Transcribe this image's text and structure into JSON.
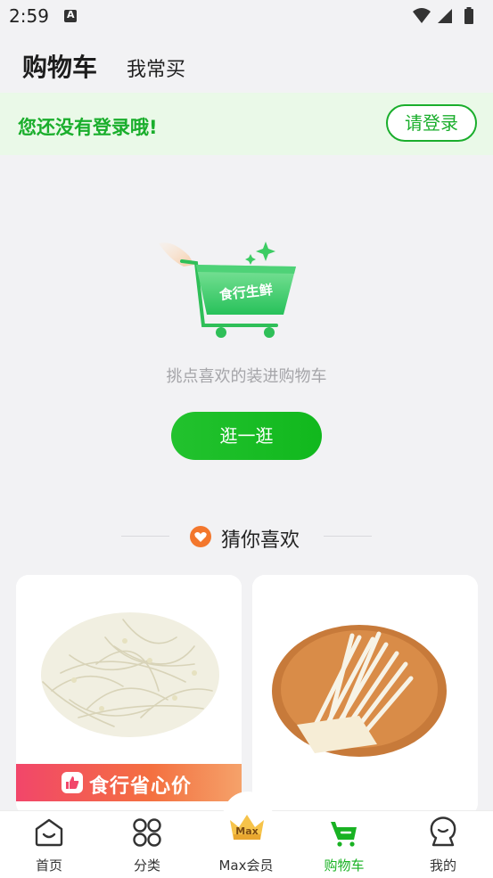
{
  "status_bar": {
    "time": "2:59"
  },
  "header": {
    "tabs": [
      {
        "label": "购物车",
        "active": true
      },
      {
        "label": "我常买",
        "active": false
      }
    ]
  },
  "login_banner": {
    "message": "您还没有登录哦!",
    "button_label": "请登录"
  },
  "empty_state": {
    "illustration_text": "食行生鲜",
    "message": "挑点喜欢的装进购物车",
    "button_label": "逛一逛"
  },
  "recommend": {
    "title": "猜你喜欢",
    "products": [
      {
        "image": "bean-sprouts",
        "promo_label": "食行省心价"
      },
      {
        "image": "enoki-mushroom",
        "promo_label": ""
      }
    ]
  },
  "tabbar": {
    "items": [
      {
        "label": "首页",
        "icon": "home-icon",
        "active": false
      },
      {
        "label": "分类",
        "icon": "category-icon",
        "active": false
      },
      {
        "label": "Max会员",
        "icon": "crown-icon",
        "badge": "Max",
        "active": false
      },
      {
        "label": "购物车",
        "icon": "cart-icon",
        "active": true
      },
      {
        "label": "我的",
        "icon": "profile-icon",
        "active": false
      }
    ]
  },
  "colors": {
    "accent": "#1aae2c",
    "banner_bg": "#eaf9e8",
    "background": "#f2f2f4",
    "promo_gradient": [
      "#f2466a",
      "#f5a26a"
    ]
  }
}
